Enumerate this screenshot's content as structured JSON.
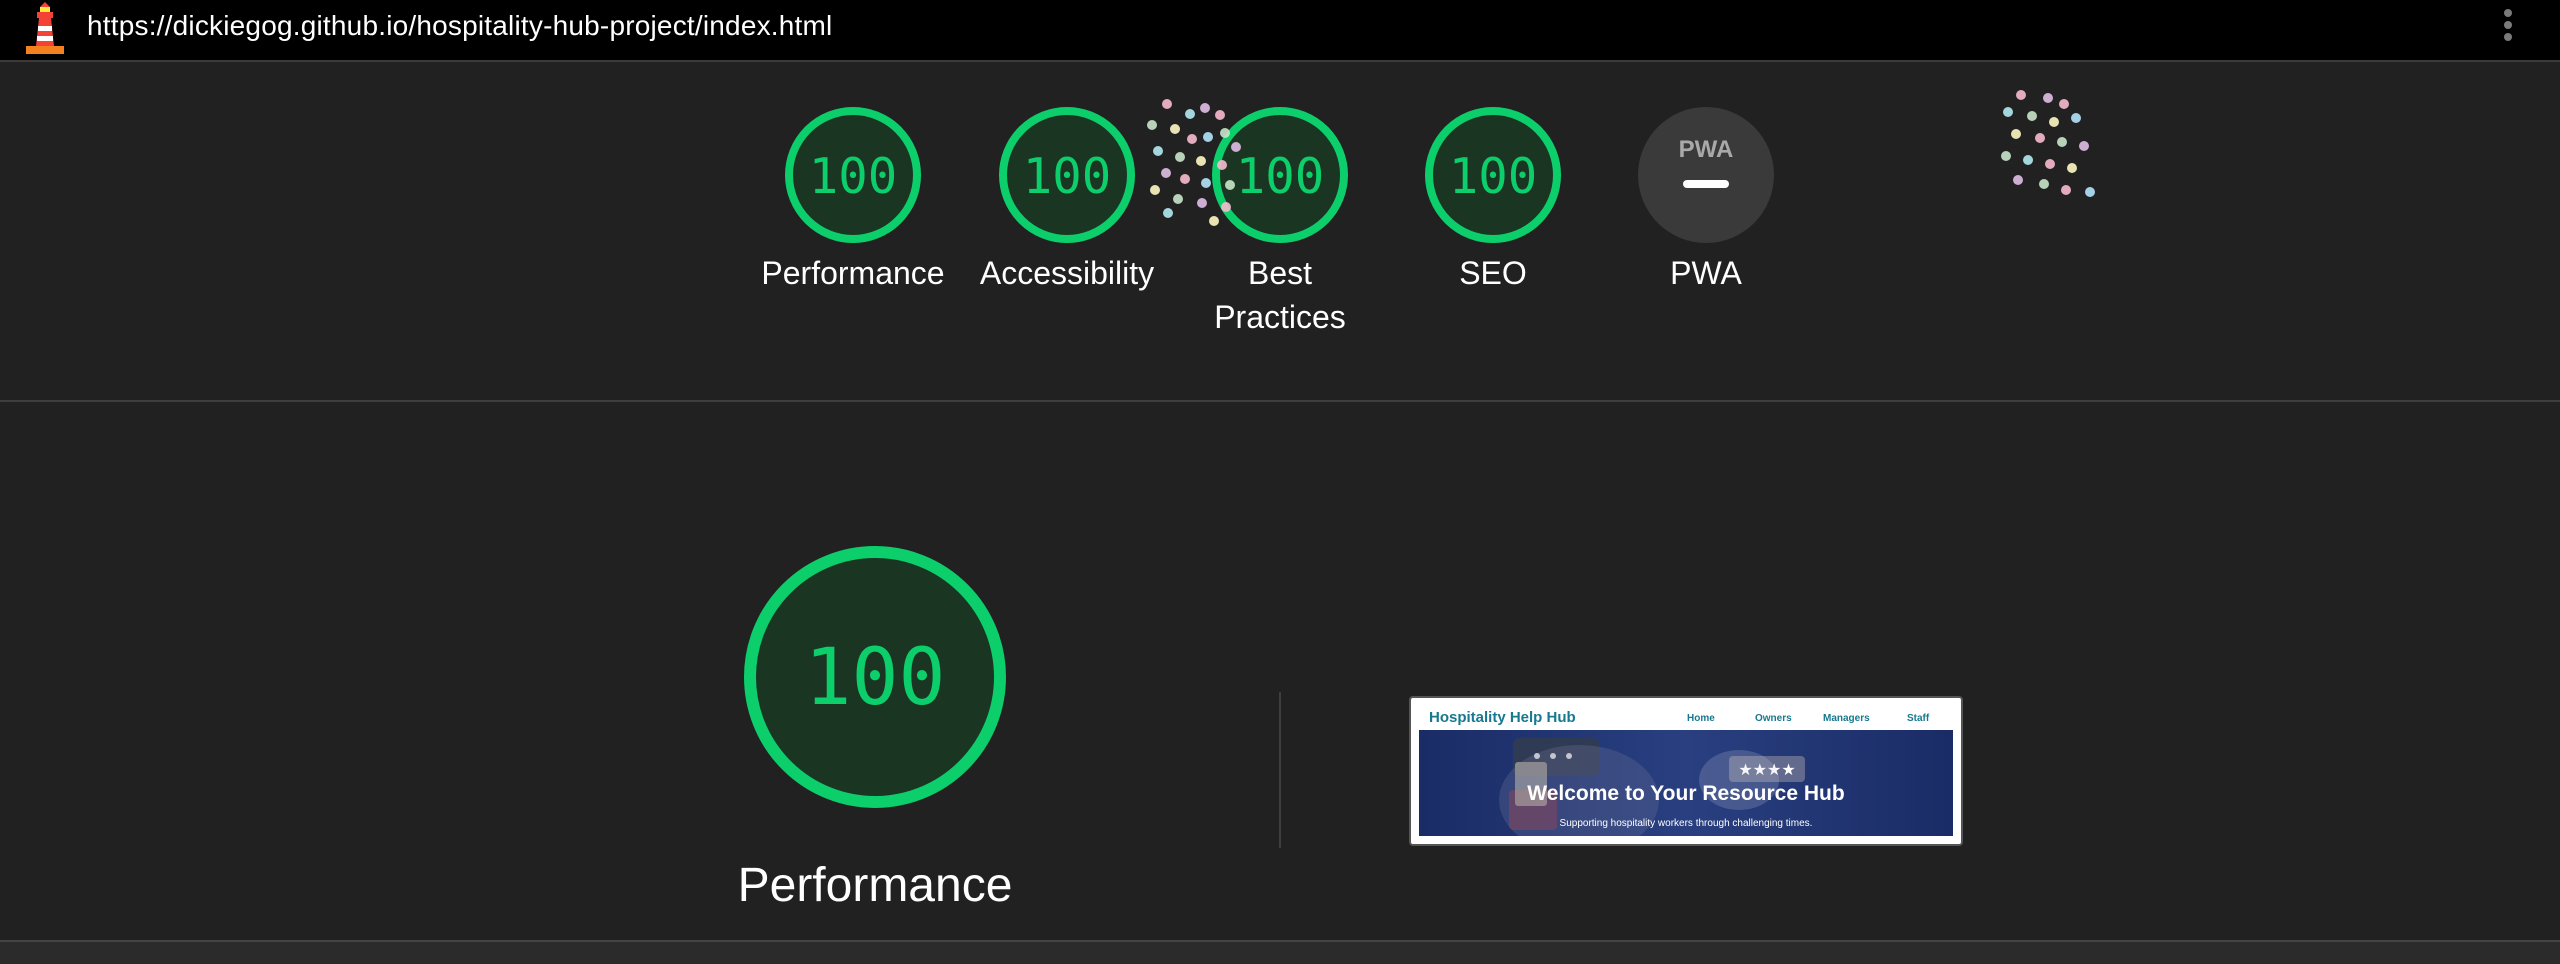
{
  "browser": {
    "url": "https://dickiegog.github.io/hospitality-hub-project/index.html"
  },
  "colors": {
    "pass": "#0cce6b",
    "pass_fill": "#1b3523",
    "na": "#3a3a3a",
    "background": "#212121"
  },
  "categories": [
    {
      "label": "Performance",
      "score": "100",
      "value": 100
    },
    {
      "label": "Accessibility",
      "score": "100",
      "value": 100
    },
    {
      "label": "Best Practices",
      "score": "100",
      "value": 100
    },
    {
      "label": "SEO",
      "score": "100",
      "value": 100
    },
    {
      "label": "PWA",
      "score": "",
      "badge": "PWA"
    }
  ],
  "performance_section": {
    "score": "100",
    "title": "Performance"
  },
  "screenshot_preview": {
    "brand": "Hospitality Help Hub",
    "nav": [
      "Home",
      "Owners",
      "Managers",
      "Staff"
    ],
    "hero_title": "Welcome to Your Resource Hub",
    "hero_subtitle": "Supporting hospitality workers through challenging times."
  },
  "icons": {
    "logo": "lighthouse-icon",
    "menu": "more-vertical-icon",
    "confetti": "confetti-icon"
  }
}
